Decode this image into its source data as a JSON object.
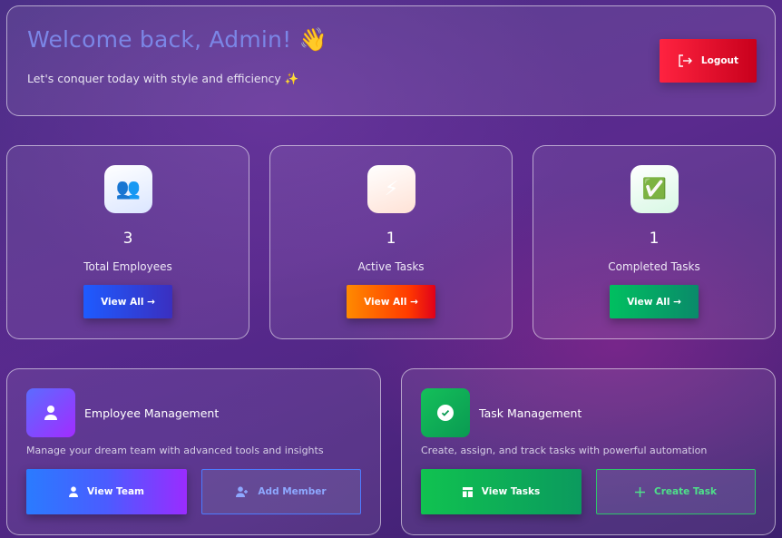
{
  "header": {
    "welcome": "Welcome back, Admin! 👋",
    "subtitle": "Let's conquer today with style and efficiency ✨",
    "logout_label": "Logout"
  },
  "stats": [
    {
      "icon": "👥",
      "value": "3",
      "label": "Total Employees",
      "button_label": "View All →"
    },
    {
      "icon": "⚡",
      "value": "1",
      "label": "Active Tasks",
      "button_label": "View All →"
    },
    {
      "icon": "✅",
      "value": "1",
      "label": "Completed Tasks",
      "button_label": "View All →"
    }
  ],
  "employee_management": {
    "title": "Employee Management",
    "description": "Manage your dream team with advanced tools and insights",
    "primary_label": "View Team",
    "secondary_label": "Add Member"
  },
  "task_management": {
    "title": "Task Management",
    "description": "Create, assign, and track tasks with powerful automation",
    "primary_label": "View Tasks",
    "secondary_label": "Create Task"
  },
  "colors": {
    "logout": "#ff2340",
    "employee_accent": "#3a63ff",
    "task_accent": "#10c250",
    "active_accent": "#ff6a00"
  }
}
